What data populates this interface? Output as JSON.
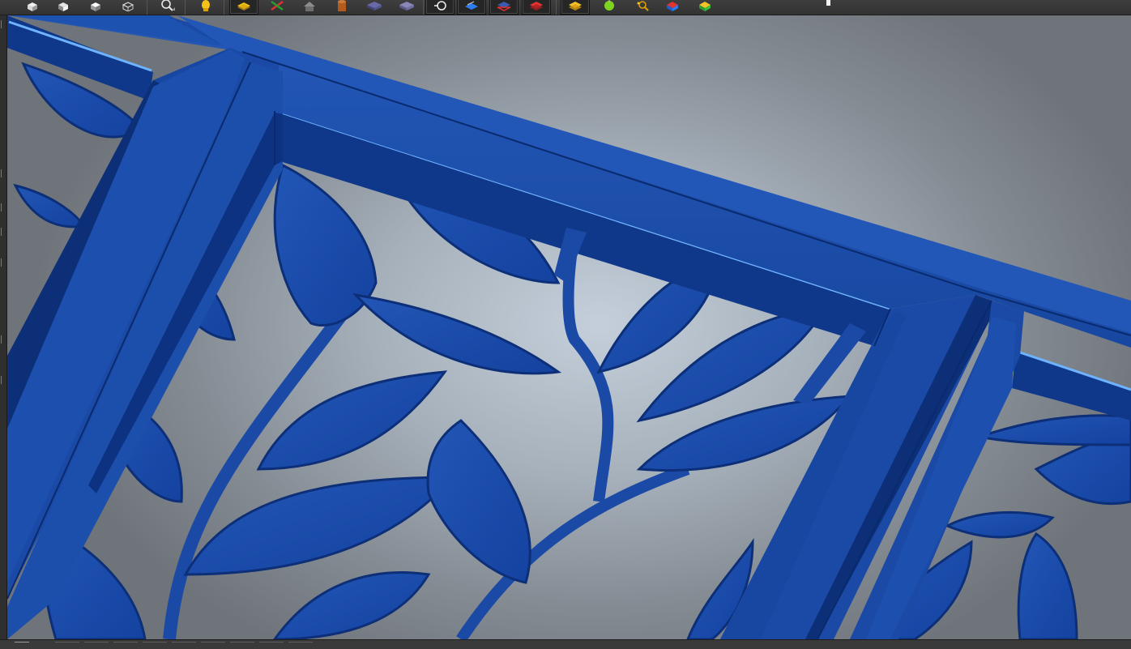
{
  "toolbar": {
    "buttons": [
      {
        "icon": "view-front-cube-icon"
      },
      {
        "icon": "view-right-cube-icon"
      },
      {
        "icon": "view-top-cube-icon"
      },
      {
        "icon": "view-iso-cube-icon"
      },
      {
        "icon": "zoom-magnifier-icon"
      },
      {
        "icon": "lighting-bulb-icon"
      },
      {
        "icon": "layer-yellow-stack-icon"
      },
      {
        "icon": "transform-axes-icon"
      },
      {
        "icon": "house-model-icon"
      },
      {
        "icon": "cylinder-icon"
      },
      {
        "icon": "blue-slab-icon"
      },
      {
        "icon": "purple-slab-icon"
      },
      {
        "icon": "rotate-view-icon"
      },
      {
        "icon": "blue-layer-icon"
      },
      {
        "icon": "red-outline-layer-icon"
      },
      {
        "icon": "red-layer-icon"
      },
      {
        "icon": "yellow-layer-icon"
      },
      {
        "icon": "green-sphere-icon"
      },
      {
        "icon": "inspect-magnifier-icon"
      },
      {
        "icon": "red-blue-cube-icon"
      },
      {
        "icon": "green-yellow-cube-icon"
      }
    ]
  },
  "colors": {
    "model_blue": "#1747a0",
    "model_blue_dark": "#0c2f78",
    "model_highlight": "#6fb3ff",
    "background_center": "#c4cfdb",
    "background_edge": "#6f747a",
    "toolbar_bg": "#3a3a3a"
  },
  "viewport": {
    "model": "leaf-pattern-panel-relief"
  }
}
